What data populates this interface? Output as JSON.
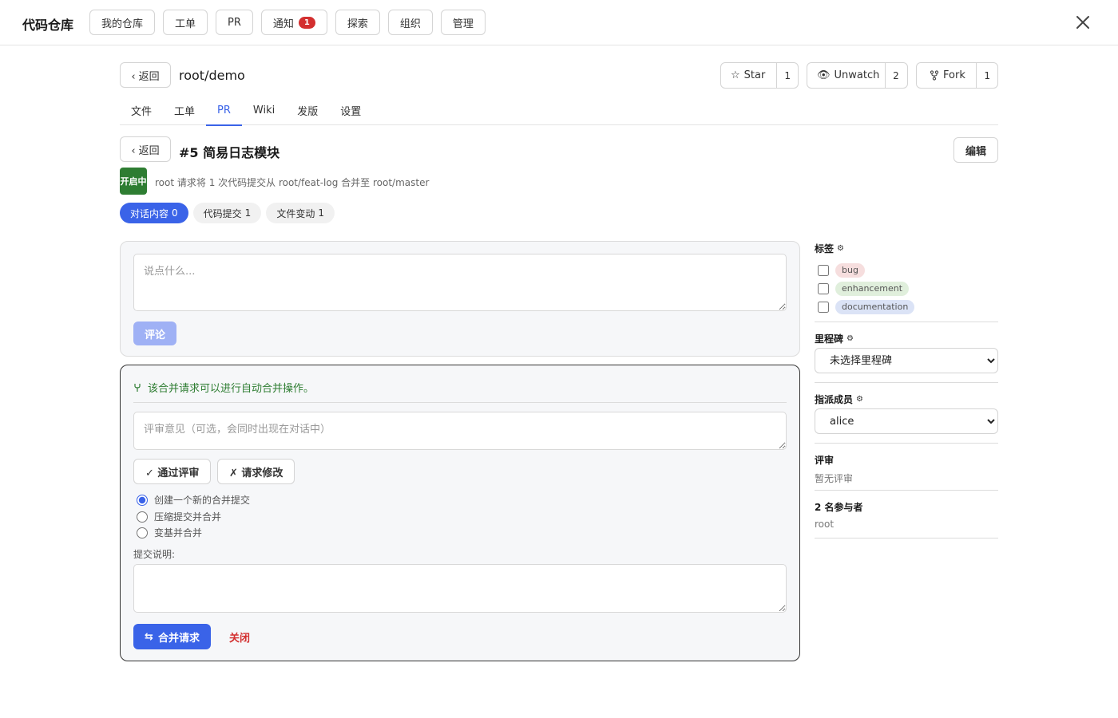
{
  "app": {
    "brand": "代码仓库"
  },
  "nav": {
    "items": [
      "我的仓库",
      "工单",
      "PR"
    ],
    "notify": {
      "label": "通知",
      "count": "1"
    },
    "items2": [
      "探索",
      "组织",
      "管理"
    ]
  },
  "repo": {
    "back": "‹ 返回",
    "title": "root/demo",
    "star": {
      "label": "Star",
      "count": "1"
    },
    "watch": {
      "label": "Unwatch",
      "count": "2"
    },
    "fork": {
      "label": "Fork",
      "count": "1"
    },
    "tabs": [
      "文件",
      "工单",
      "PR",
      "Wiki",
      "发版",
      "设置"
    ],
    "active_tab": "PR"
  },
  "pr": {
    "back": "‹ 返回",
    "title": "#5 简易日志模块",
    "edit": "编辑",
    "state": "开启中",
    "meta": "root 请求将 1 次代码提交从 root/feat-log 合并至 root/master",
    "pills": [
      {
        "label": "对话内容",
        "count": "0"
      },
      {
        "label": "代码提交",
        "count": "1"
      },
      {
        "label": "文件变动",
        "count": "1"
      }
    ]
  },
  "comment": {
    "placeholder": "说点什么...",
    "submit": "评论"
  },
  "merge": {
    "status": "该合并请求可以进行自动合并操作。",
    "review_placeholder": "评审意见（可选，会同时出现在对话中）",
    "approve": "✓ 通过评审",
    "request_changes": "✗ 请求修改",
    "options": [
      "创建一个新的合并提交",
      "压缩提交并合并",
      "变基并合并"
    ],
    "selected_option": 0,
    "message_label": "提交说明:",
    "merge_button": "合并请求",
    "close_button": "关闭"
  },
  "sidebar": {
    "labels_title": "标签",
    "labels": [
      {
        "name": "bug",
        "color": "#f6dede"
      },
      {
        "name": "enhancement",
        "color": "#e0efdc"
      },
      {
        "name": "documentation",
        "color": "#dbe3f6"
      }
    ],
    "milestone_title": "里程碑",
    "milestone_value": "未选择里程碑",
    "assignee_title": "指派成员",
    "assignee_value": "alice",
    "review_title": "评审",
    "review_value": "暂无评审",
    "participants_title": "2 名参与者",
    "participants_value": "root"
  },
  "colors": {
    "accent": "#3a63e8",
    "success": "#2e7d32",
    "danger": "#d32f2f"
  }
}
